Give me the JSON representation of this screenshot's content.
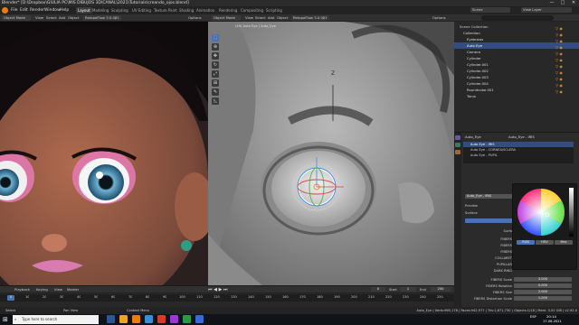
{
  "window": {
    "title": "Blender* [D:\\Dropbox\\GIULIA PC\\MIS DIBUJOS 3D\\CANAL\\2021\\Tutorials\\creando_ojos.blend]",
    "controls": [
      "—",
      "□",
      "✕"
    ]
  },
  "menu": [
    "File",
    "Edit",
    "Render",
    "Window",
    "Help"
  ],
  "workspaces": [
    "Layout",
    "Modeling",
    "Sculpting",
    "UV Editing",
    "Texture Paint",
    "Shading",
    "Animation",
    "Rendering",
    "Compositing",
    "Scripting"
  ],
  "left_view": {
    "mode": "Object Mode",
    "menus": [
      "View",
      "Select",
      "Add",
      "Object"
    ],
    "render_engine": "RetopoFlow 3.0.0β1",
    "options": "Options"
  },
  "right_view": {
    "mode": "Object Mode",
    "menus": [
      "View",
      "Select",
      "Add",
      "Object"
    ],
    "render_engine": "RetopoFlow 3.0.0β1",
    "options": "Options",
    "overlay_label": "(49) Auto Eye | Auto_Eye",
    "axis": "Z",
    "global": "Global"
  },
  "top_right": {
    "scene_label": "Scene",
    "view_layer_label": "View Layer"
  },
  "outliner": {
    "search_placeholder": "",
    "items": [
      {
        "label": "Scene Collection",
        "color": "#cccccc"
      },
      {
        "label": "Collection",
        "color": "#cccccc"
      },
      {
        "label": "Eyebrows",
        "color": "#cccccc"
      },
      {
        "label": "Auto Eye",
        "color": "#ffffff",
        "selected": true
      },
      {
        "label": "Camera",
        "color": "#cccccc"
      },
      {
        "label": "Cylinder",
        "color": "#cccccc"
      },
      {
        "label": "Cylinder.001",
        "color": "#cccccc"
      },
      {
        "label": "Cylinder.002",
        "color": "#cccccc"
      },
      {
        "label": "Cylinder.003",
        "color": "#cccccc"
      },
      {
        "label": "Cylinder.004",
        "color": "#cccccc"
      },
      {
        "label": "Roundcube.001",
        "color": "#cccccc"
      },
      {
        "label": "Torus",
        "color": "#cccccc"
      }
    ]
  },
  "properties": {
    "object_name": "Auto_Eye",
    "material_name": "Auto_Eye - IRIS",
    "materials": [
      "Auto Eye - IRIS",
      "Auto Eye - CORNEA/SCLERA",
      "Auto Eye - PUPIL"
    ],
    "slot_name": "Auto_Eye - IRIS",
    "sections": [
      "Preview",
      "Surface"
    ],
    "fields": [
      {
        "label": "Surfa",
        "value": ""
      },
      {
        "label": "FIBERS",
        "value": ""
      },
      {
        "label": "FIBERS",
        "value": "0.417"
      },
      {
        "label": "FIBERS",
        "value": "0.669"
      },
      {
        "label": "COLLARET",
        "value": "0.370"
      },
      {
        "label": "PUPILLAR",
        "value": "0.370"
      },
      {
        "label": "DARK RING",
        "value": ""
      },
      {
        "label": "FIBERS Scale",
        "value": "3.000"
      },
      {
        "label": "FIBERS Rotation",
        "value": "0.000"
      },
      {
        "label": "FIBERS Size",
        "value": "2.000"
      },
      {
        "label": "FIBERS Distortion Scale",
        "value": "1.000"
      }
    ],
    "color_tabs": [
      "RGB",
      "HSV",
      "Hex"
    ]
  },
  "timeline": {
    "menus": [
      "Playback",
      "Keying",
      "View",
      "Marker"
    ],
    "current_frame": "0",
    "ticks": [
      "0",
      "10",
      "20",
      "30",
      "40",
      "50",
      "60",
      "70",
      "80",
      "90",
      "100",
      "110",
      "120",
      "130",
      "140",
      "150",
      "160",
      "170",
      "180",
      "190",
      "200",
      "210",
      "220",
      "230",
      "240",
      "250"
    ],
    "start": "1",
    "end": "250",
    "start_label": "Start",
    "end_label": "End"
  },
  "statusbar": {
    "left": "Select",
    "middle": "Pan View",
    "right": "Context Menu",
    "stats": "Auto_Eye | Verts:960,178 | Faces:942,977 | Tris:1,871,730 | Objects:1/18 | Mem: 3.02 GiB | v2.92.0"
  },
  "taskbar": {
    "search_placeholder": "Type here to search",
    "lang": "ESP",
    "time": "20:14",
    "date": "17-06-2021"
  },
  "colors": {
    "accent": "#4772b3",
    "selection": "#ff8c1a",
    "bg": "#1d1d1d"
  }
}
